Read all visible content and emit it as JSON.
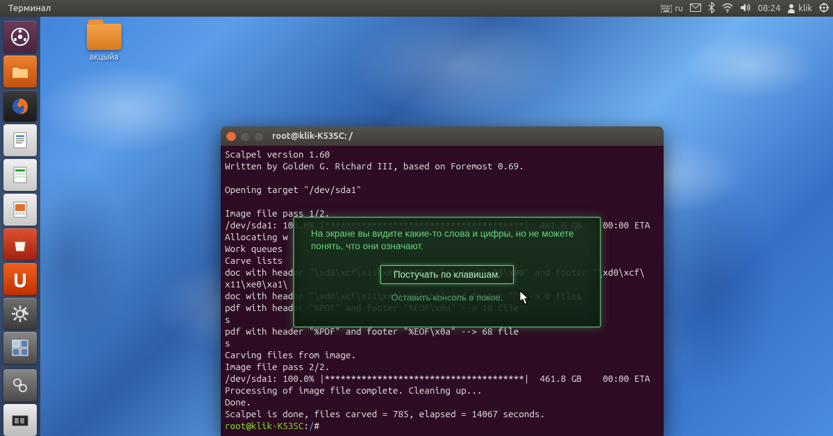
{
  "topbar": {
    "app_name": "Терминал",
    "lang": "ru",
    "time": "08:24",
    "user": "klik"
  },
  "desktop": {
    "folder_label": "акцыйа"
  },
  "terminal": {
    "title": "root@klik-K53SC: /",
    "lines": [
      "Scalpel version 1.60",
      "Written by Golden G. Richard III, based on Foremost 0.69.",
      "",
      "Opening target \"/dev/sda1\"",
      "",
      "Image file pass 1/2.",
      "/dev/sda1: 100.0% |**************************************|  461.8 GB    00:00 ETA",
      "Allocating w",
      "Work queues ",
      "Carve lists ",
      "doc with header \"\\xd0\\xcf\\x11\\xe0\\xa1\\xb1\\x1a\\xe1\\x00\\x00\" and footer \"\\xd0\\xcf\\",
      "x11\\xe0\\xa1\\",
      "doc with header \"\\xd0\\xcf\\x11\\xe0\\xa1\\xb1\" and footer \"\" --> 0 files",
      "pdf with header \"%PDF\" and footer \"%EOF\\x0d\" --> 10 file",
      "s",
      "pdf with header \"%PDF\" and footer \"%EOF\\x0a\" --> 68 file",
      "s",
      "Carving files from image.",
      "Image file pass 2/2.",
      "/dev/sda1: 100.0% |**************************************|  461.8 GB    00:00 ETA",
      "Processing of image file complete. Cleaning up...",
      "Done.",
      "Scalpel is done, files carved = 785, elapsed = 14067 seconds."
    ],
    "prompt_host": "root@klik-K53SC",
    "prompt_path": "/",
    "prompt_tail": "# "
  },
  "dialog": {
    "message": "На экране вы видите какие-то слова и цифры, но не можете понять, что они означают.",
    "primary": "Постучать по клавишам.",
    "secondary": "Оставить консоль в покое."
  },
  "launcher": {
    "items": [
      {
        "name": "dash",
        "label": "Dash"
      },
      {
        "name": "files",
        "label": "Files"
      },
      {
        "name": "firefox",
        "label": "Firefox"
      },
      {
        "name": "writer",
        "label": "LibreOffice Writer"
      },
      {
        "name": "calc",
        "label": "LibreOffice Calc"
      },
      {
        "name": "impress",
        "label": "LibreOffice Impress"
      },
      {
        "name": "software",
        "label": "Ubuntu Software"
      },
      {
        "name": "ubuntuone",
        "label": "Ubuntu One"
      },
      {
        "name": "settings",
        "label": "System Settings"
      },
      {
        "name": "workspace",
        "label": "Workspace Switcher"
      }
    ]
  }
}
